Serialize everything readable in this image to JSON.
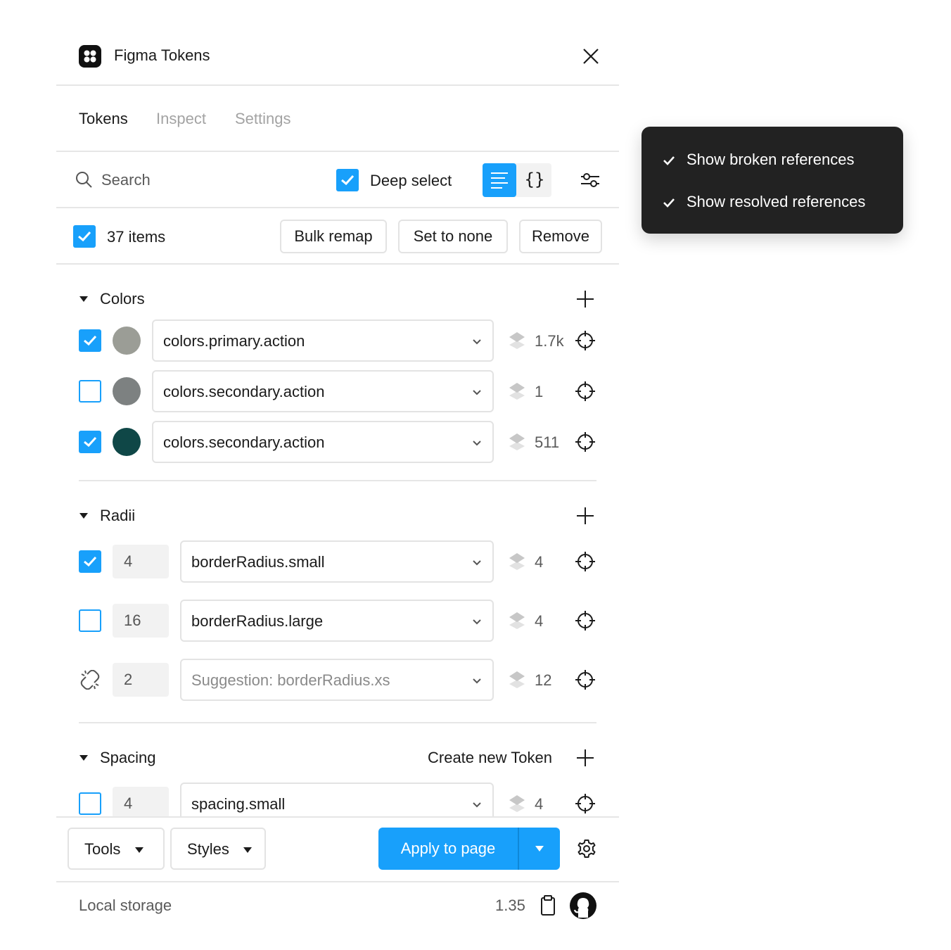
{
  "header": {
    "title": "Figma Tokens"
  },
  "tabs": [
    {
      "label": "Tokens",
      "active": true
    },
    {
      "label": "Inspect",
      "active": false
    },
    {
      "label": "Settings",
      "active": false
    }
  ],
  "search": {
    "placeholder": "Search"
  },
  "deep_select": {
    "label": "Deep select",
    "checked": true
  },
  "bulk": {
    "count_label": "37 items",
    "checked": true,
    "bulk_remap": "Bulk remap",
    "set_to_none": "Set to none",
    "remove": "Remove"
  },
  "sections": {
    "colors": {
      "title": "Colors",
      "rows": [
        {
          "checked": true,
          "swatch": "#9b9d96",
          "token": "colors.primary.action",
          "count": "1.7k"
        },
        {
          "checked": false,
          "swatch": "#7d8181",
          "token": "colors.secondary.action",
          "count": "1"
        },
        {
          "checked": true,
          "swatch": "#0f4747",
          "token": "colors.secondary.action",
          "count": "511"
        }
      ]
    },
    "radii": {
      "title": "Radii",
      "rows": [
        {
          "checked": true,
          "value": "4",
          "token": "borderRadius.small",
          "count": "4"
        },
        {
          "checked": false,
          "value": "16",
          "token": "borderRadius.large",
          "count": "4"
        },
        {
          "broken": true,
          "value": "2",
          "token": "Suggestion: borderRadius.xs",
          "count": "12"
        }
      ]
    },
    "spacing": {
      "title": "Spacing",
      "create_label": "Create new Token",
      "rows": [
        {
          "checked": false,
          "value": "4",
          "token": "spacing.small",
          "count": "4"
        }
      ]
    }
  },
  "toolbar": {
    "tools": "Tools",
    "styles": "Styles",
    "apply": "Apply to page"
  },
  "footer": {
    "storage": "Local storage",
    "version": "1.35"
  },
  "popover": {
    "items": [
      {
        "label": "Show broken references",
        "checked": true
      },
      {
        "label": "Show resolved references",
        "checked": true
      }
    ]
  },
  "colors": {
    "accent": "#18a0fb",
    "popover_bg": "#222222"
  },
  "icons": [
    "figma-logo-icon",
    "close-icon",
    "search-icon",
    "list-view-icon",
    "json-view-icon",
    "filter-icon",
    "plus-icon",
    "chevron-down-icon",
    "layers-icon",
    "target-icon",
    "broken-link-icon",
    "gear-icon",
    "clipboard-icon",
    "github-icon",
    "check-icon"
  ]
}
